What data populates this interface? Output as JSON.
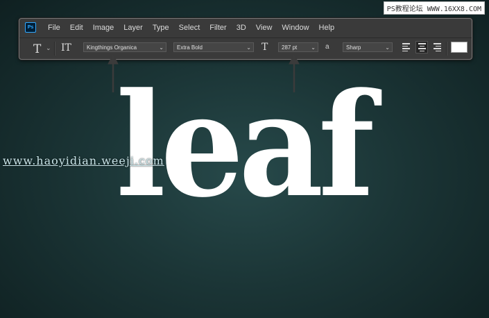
{
  "watermark_top": "PS教程论坛 WWW.16XX8.COM",
  "watermark_mid": "www.haoyidian.weeji.com",
  "app": {
    "logo": "Ps"
  },
  "menu": [
    "File",
    "Edit",
    "Image",
    "Layer",
    "Type",
    "Select",
    "Filter",
    "3D",
    "View",
    "Window",
    "Help"
  ],
  "options": {
    "tool_glyph": "T",
    "orientation_glyph": "IT",
    "font_family": "Kingthings Organica",
    "font_style": "Extra Bold",
    "size_glyph": "T",
    "font_size": "287 pt",
    "aa_glyph": "a",
    "antialias": "Sharp",
    "text_color": "#ffffff"
  },
  "canvas_text": "leaf",
  "colors": {
    "background": "#1b3536",
    "toolbar": "#3a3a3a",
    "arrow": "#3b3b3b"
  }
}
